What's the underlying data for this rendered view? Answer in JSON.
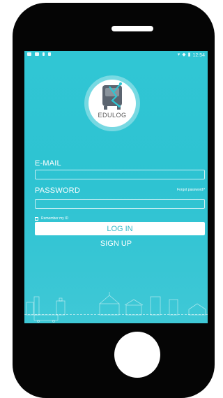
{
  "status_bar": {
    "time": "12:54"
  },
  "logo": {
    "text": "EDULOG"
  },
  "form": {
    "email_label": "E-MAIL",
    "email_value": "",
    "password_label": "PASSWORD",
    "password_value": "",
    "forgot_label": "Forgot password?",
    "remember_label": "Remember my ID"
  },
  "actions": {
    "login_label": "LOG IN",
    "signup_label": "SIGN UP"
  },
  "colors": {
    "screen_bg": "#2ec3d2",
    "accent_text": "#2eb8c8",
    "logo_dark": "#5b6470",
    "logo_teal": "#2ec6d2"
  }
}
